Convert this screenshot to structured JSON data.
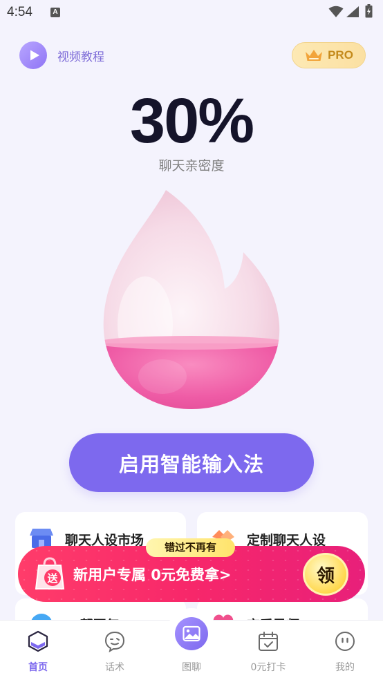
{
  "status_bar": {
    "time": "4:54",
    "notification_glyph": "A"
  },
  "header": {
    "video_tutorial_label": "视频教程",
    "pro_label": "PRO"
  },
  "intimacy": {
    "percent": "30%",
    "label": "聊天亲密度",
    "fill_fraction": 0.3
  },
  "main_button": {
    "label": "启用智能输入法"
  },
  "cards": [
    {
      "title": "聊天人设市场",
      "icon": "storefront-icon"
    },
    {
      "title": "定制聊天人设",
      "icon": "handshake-icon"
    },
    {
      "title": "AI帮回复",
      "icon": "ai-reply-icon"
    },
    {
      "title": "恋爱导师",
      "icon": "heart-icon"
    }
  ],
  "promo": {
    "tag": "错过不再有",
    "gift_badge": "送",
    "text": "新用户专属 0元免费拿>",
    "claim_label": "领"
  },
  "bottom_nav": {
    "items": [
      {
        "label": "首页",
        "icon": "home-icon",
        "active": true
      },
      {
        "label": "话术",
        "icon": "chat-face-icon",
        "active": false
      },
      {
        "label": "图聊",
        "icon": "image-icon",
        "active": false
      },
      {
        "label": "0元打卡",
        "icon": "calendar-check-icon",
        "active": false
      },
      {
        "label": "我的",
        "icon": "profile-face-icon",
        "active": false
      }
    ]
  },
  "colors": {
    "accent": "#7d69ee",
    "background": "#f4f3fd",
    "promo_pink": "#f7276a",
    "gold": "#ffd84e"
  }
}
